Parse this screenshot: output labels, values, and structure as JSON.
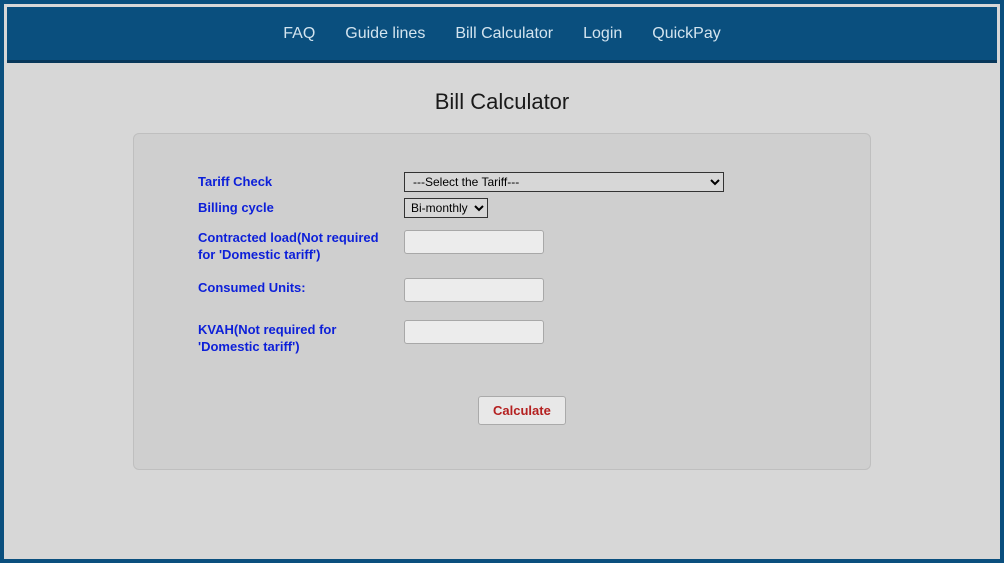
{
  "nav": {
    "faq": "FAQ",
    "guidelines": "Guide lines",
    "billcalc": "Bill Calculator",
    "login": "Login",
    "quickpay": "QuickPay"
  },
  "page": {
    "title": "Bill Calculator"
  },
  "form": {
    "tariff": {
      "label": "Tariff Check",
      "selected": "---Select the Tariff---"
    },
    "billing_cycle": {
      "label": "Billing cycle",
      "selected": "Bi-monthly"
    },
    "contracted_load": {
      "label": "Contracted load(Not required for 'Domestic tariff')",
      "value": ""
    },
    "consumed_units": {
      "label": "Consumed Units:",
      "value": ""
    },
    "kvah": {
      "label": "KVAH(Not required for 'Domestic tariff')",
      "value": ""
    },
    "calculate_label": "Calculate"
  }
}
